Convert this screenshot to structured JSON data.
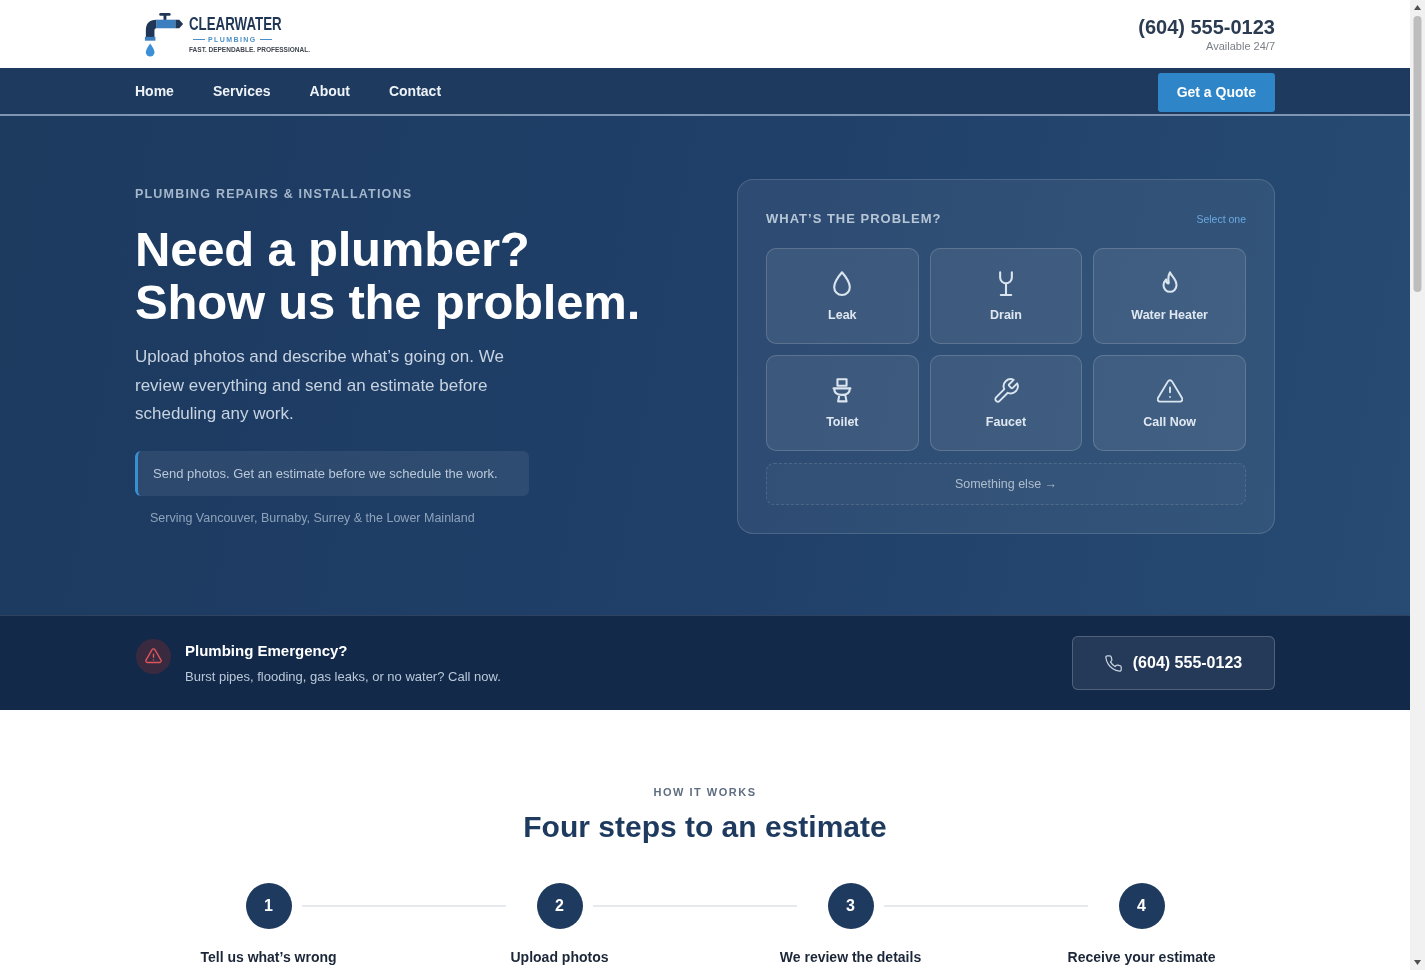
{
  "header": {
    "logo": {
      "wordmark": "CLEARWATER",
      "subtitle": "PLUMBING",
      "tagline": "FAST. DEPENDABLE. PROFESSIONAL."
    },
    "phone": "(604) 555-0123",
    "availability": "Available 24/7"
  },
  "nav": {
    "links": [
      {
        "label": "Home"
      },
      {
        "label": "Services"
      },
      {
        "label": "About"
      },
      {
        "label": "Contact"
      }
    ],
    "cta": "Get a Quote"
  },
  "hero": {
    "eyebrow": "PLUMBING REPAIRS & INSTALLATIONS",
    "title_lines": [
      "Need a plumber?",
      "Show us the problem."
    ],
    "intro": "Upload photos and describe what’s going on. We review everything and send an estimate before scheduling any work.",
    "callout": "Send photos. Get an estimate before we schedule the work.",
    "service_area": "Serving Vancouver, Burnaby, Surrey & the Lower Mainland"
  },
  "problem_card": {
    "title": "WHAT’S THE PROBLEM?",
    "hint": "Select one",
    "options": [
      {
        "label": "Leak",
        "selected": false
      },
      {
        "label": "Drain",
        "selected": false
      },
      {
        "label": "Water Heater",
        "selected": false
      },
      {
        "label": "Toilet",
        "selected": false
      },
      {
        "label": "Faucet",
        "selected": false
      },
      {
        "label": "Call Now",
        "selected": false
      }
    ],
    "other": "Something else →"
  },
  "emergency": {
    "title": "Plumbing Emergency?",
    "text": "Burst pipes, flooding, gas leaks, or no water? Call now.",
    "phone": "(604) 555-0123"
  },
  "how_it_works": {
    "eyebrow": "HOW IT WORKS",
    "title": "Four steps to an estimate",
    "steps": [
      {
        "number": "1",
        "label": "Tell us what’s wrong"
      },
      {
        "number": "2",
        "label": "Upload photos"
      },
      {
        "number": "3",
        "label": "We review the details"
      },
      {
        "number": "4",
        "label": "Receive your estimate"
      }
    ]
  }
}
